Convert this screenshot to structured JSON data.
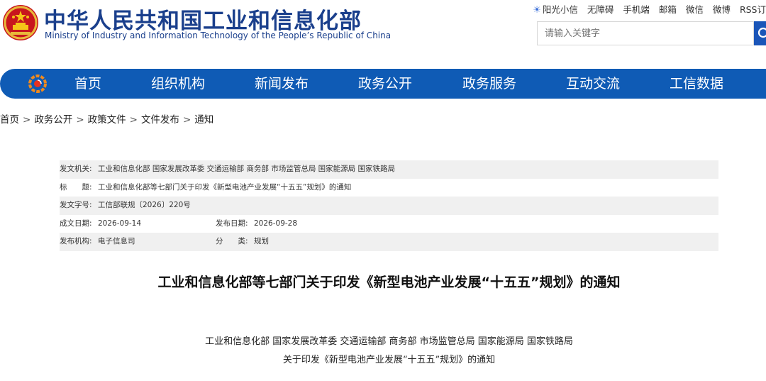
{
  "header": {
    "site_title": "中华人民共和国工业和信息化部",
    "site_subtitle": "Ministry of Industry and Information Technology of the People’s Republic of China",
    "emblem_icon": "national-emblem-icon",
    "top_links": [
      "阳光小信",
      "无障碍",
      "手机端",
      "邮箱",
      "微信",
      "微博",
      "RSS订"
    ],
    "search_placeholder": "请输入关键字",
    "brand_color": "#1a3f8c",
    "nav_color": "#0f5bb5"
  },
  "nav": {
    "items": [
      "首页",
      "组织机构",
      "新闻发布",
      "政务公开",
      "政务服务",
      "互动交流",
      "工信数据"
    ]
  },
  "breadcrumb": [
    "首页",
    "政务公开",
    "政策文件",
    "文件发布",
    "通知"
  ],
  "meta": {
    "issuer_label": "发文机关:",
    "issuer_value": "工业和信息化部 国家发展改革委 交通运输部 商务部 市场监管总局 国家能源局 国家铁路局",
    "title_label": "标　　题:",
    "title_value": "工业和信息化部等七部门关于印发《新型电池产业发展“十五五”规划》的通知",
    "docno_label": "发文字号:",
    "docno_value": "工信部联规〔2026〕220号",
    "created_label": "成文日期:",
    "created_value": "2026-09-14",
    "published_label": "发布日期:",
    "published_value": "2026-09-28",
    "org_label": "发布机构:",
    "org_value": "电子信息司",
    "category_label": "分　　类:",
    "category_value": "规划"
  },
  "document": {
    "title": "工业和信息化部等七部门关于印发《新型电池产业发展“十五五”规划》的通知",
    "issuers_line": "工业和信息化部  国家发展改革委  交通运输部  商务部  市场监管总局  国家能源局  国家铁路局",
    "subject_line": "关于印发《新型电池产业发展“十五五”规划》的通知"
  }
}
